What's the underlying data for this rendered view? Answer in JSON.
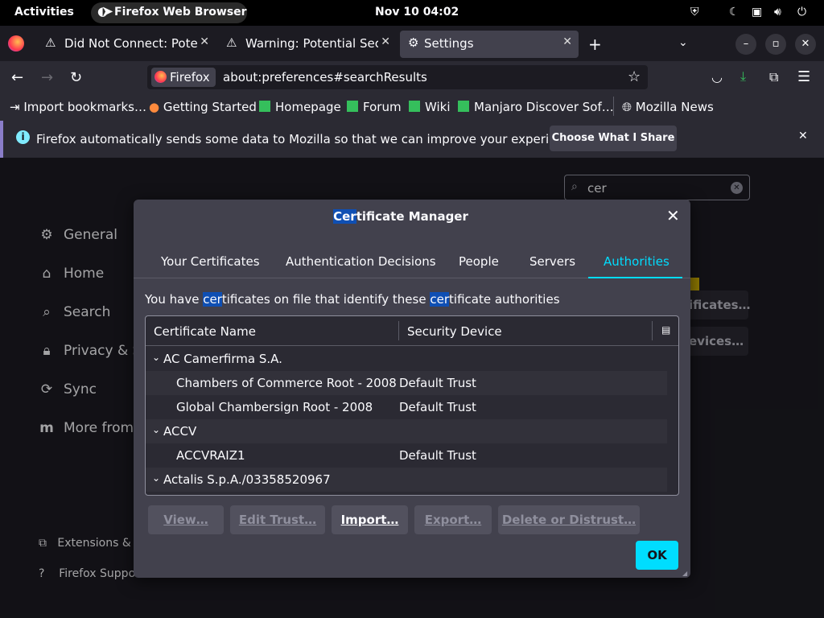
{
  "topbar": {
    "activities": "Activities",
    "app_name": "Firefox Web Browser",
    "clock": "Nov 10  04:02"
  },
  "tabs": [
    {
      "label": "Did Not Connect: Potent",
      "icon": "warning-icon"
    },
    {
      "label": "Warning: Potential Secu",
      "icon": "warning-icon"
    },
    {
      "label": "Settings",
      "icon": "gear-icon"
    }
  ],
  "navbar": {
    "identity_label": "Firefox",
    "url": "about:preferences#searchResults"
  },
  "bookmarks": [
    "Import bookmarks…",
    "Getting Started",
    "Homepage",
    "Forum",
    "Wiki",
    "Manjaro Discover Sof…",
    "Mozilla News"
  ],
  "notice": {
    "text": "Firefox automatically sends some data to Mozilla so that we can improve your experience.",
    "button": "Choose What I Share"
  },
  "prefs": {
    "search_value": "cer",
    "sidebar": [
      "General",
      "Home",
      "Search",
      "Privacy & Se",
      "Sync",
      "More from I"
    ],
    "sidebar_bottom": [
      "Extensions & T",
      "Firefox Suppo"
    ],
    "behind_buttons": [
      "ificates…",
      "evices…"
    ]
  },
  "dialog": {
    "title_hl": "Cer",
    "title_rest": "tificate Manager",
    "tabs": [
      "Your Certificates",
      "Authentication Decisions",
      "People",
      "Servers",
      "Authorities"
    ],
    "desc_1": "You have ",
    "desc_hl1": "cer",
    "desc_2": "tificates on file that identify these ",
    "desc_hl2": "cer",
    "desc_3": "tificate authorities",
    "columns": [
      "Certificate Name",
      "Security Device"
    ],
    "rows": [
      {
        "name": "AC Camerfirma S.A.",
        "device": "",
        "group": true
      },
      {
        "name": "Chambers of Commerce Root - 2008",
        "device": "Default Trust",
        "group": false
      },
      {
        "name": "Global Chambersign Root - 2008",
        "device": "Default Trust",
        "group": false
      },
      {
        "name": "ACCV",
        "device": "",
        "group": true
      },
      {
        "name": "ACCVRAIZ1",
        "device": "Default Trust",
        "group": false
      },
      {
        "name": "Actalis S.p.A./03358520967",
        "device": "",
        "group": true
      }
    ],
    "buttons": [
      "View…",
      "Edit Trust…",
      "Import…",
      "Export…",
      "Delete or Distrust…"
    ],
    "ok": "OK"
  }
}
